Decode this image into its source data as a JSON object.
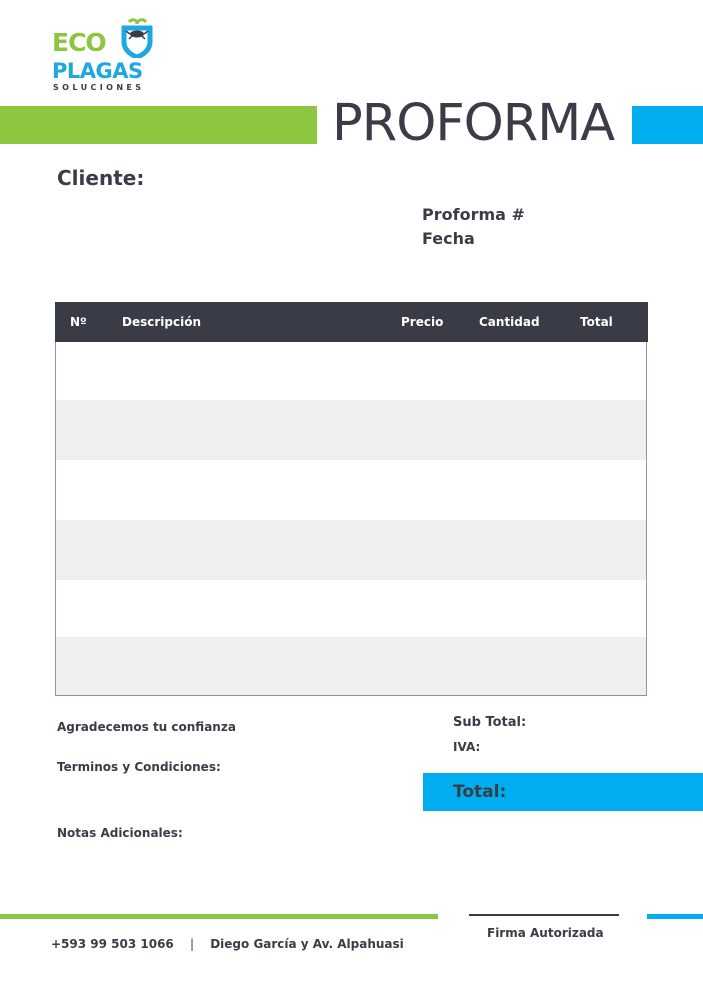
{
  "logo": {
    "line1": "ECO",
    "line2": "PLAGAS",
    "line3": "SOLUCIONES"
  },
  "header": {
    "title": "PROFORMA"
  },
  "client": {
    "label": "Cliente:"
  },
  "meta": {
    "proforma_label": "Proforma #",
    "date_label": "Fecha"
  },
  "table": {
    "columns": [
      "Nº",
      "Descripción",
      "Precio",
      "Cantidad",
      "Total"
    ]
  },
  "notes": {
    "thanks": "Agradecemos tu confianza",
    "terms": "Terminos y Condiciones:",
    "additional": "Notas Adicionales:"
  },
  "totals": {
    "subtotal_label": "Sub Total:",
    "iva_label": "IVA:",
    "total_label": "Total:"
  },
  "footer": {
    "phone": "+593 99 503 1066",
    "separator": "|",
    "address": "Diego García y Av. Alpahuasi",
    "signature_label": "Firma Autorizada"
  },
  "colors": {
    "green": "#8dc63f",
    "blue": "#00aeef",
    "dark": "#393c47"
  }
}
